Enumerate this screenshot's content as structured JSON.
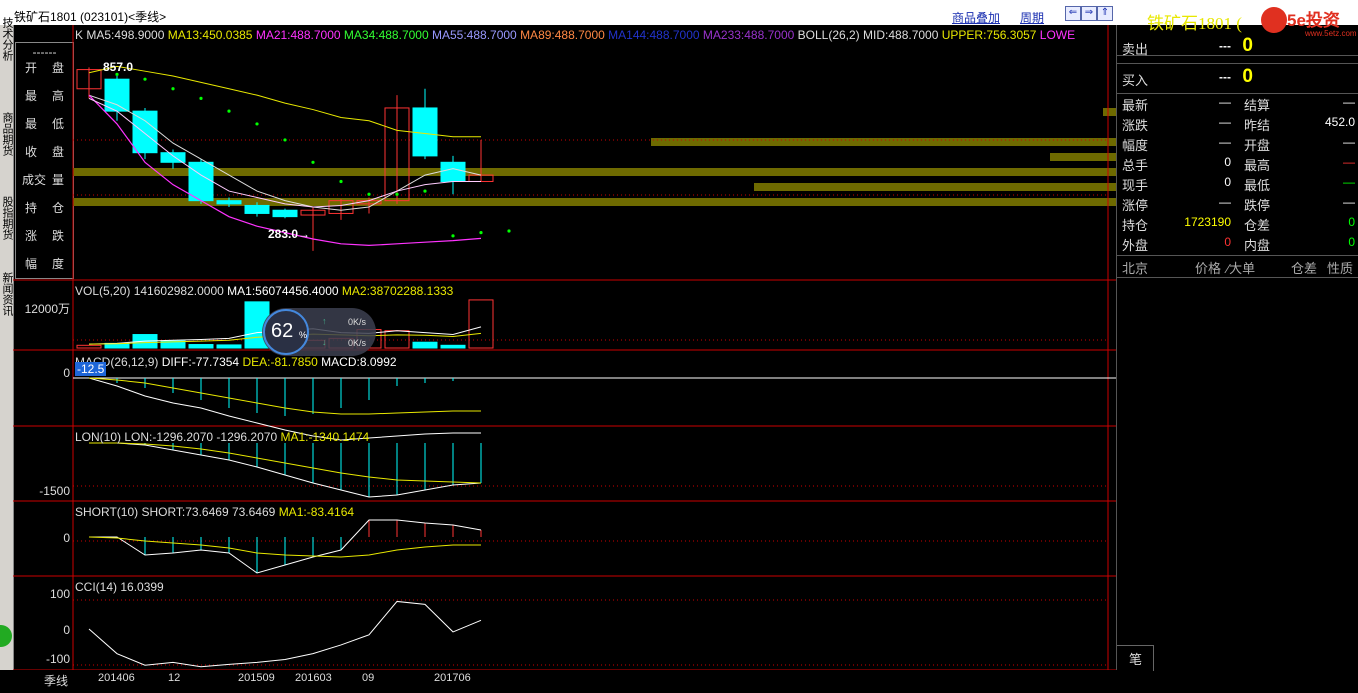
{
  "window": {
    "title": "铁矿石1801 (023101)<季线>",
    "links": {
      "overlay": "商品叠加",
      "period": "周期"
    },
    "nav_buttons": [
      "⇐",
      "⇒",
      "⇑",
      "⇓"
    ]
  },
  "left_tabs": [
    "技术分析",
    "商品期货",
    "股指期货",
    "新闻资讯"
  ],
  "info_box": {
    "dashes": "------",
    "rows": [
      {
        "a": "开",
        "b": "盘"
      },
      {
        "a": "最",
        "b": "高"
      },
      {
        "a": "最",
        "b": "低"
      },
      {
        "a": "收",
        "b": "盘"
      },
      {
        "a": "成交",
        "b": "量"
      },
      {
        "a": "持",
        "b": "仓"
      },
      {
        "a": "涨",
        "b": "跌"
      },
      {
        "a": "幅",
        "b": "度"
      }
    ]
  },
  "kline_header": [
    {
      "text": "K",
      "color": "#dddddd"
    },
    {
      "text": "MA5:498.9000",
      "color": "#dddddd"
    },
    {
      "text": "MA13:450.0385",
      "color": "#e8e800"
    },
    {
      "text": "MA21:488.7000",
      "color": "#ff33ff"
    },
    {
      "text": "MA34:488.7000",
      "color": "#33ff33"
    },
    {
      "text": "MA55:488.7000",
      "color": "#9999ff"
    },
    {
      "text": "MA89:488.7000",
      "color": "#ff8844"
    },
    {
      "text": "MA144:488.7000",
      "color": "#2233cc"
    },
    {
      "text": "MA233:488.7000",
      "color": "#9933cc"
    },
    {
      "text": "BOLL(26,2)",
      "color": "#dddddd"
    },
    {
      "text": "MID:488.7000",
      "color": "#dddddd"
    },
    {
      "text": "UPPER:756.3057",
      "color": "#e8e800"
    },
    {
      "text": "LOWE",
      "color": "#ff33ff"
    }
  ],
  "kline_marks": {
    "high": "857.0",
    "low": "283.0→"
  },
  "candles": [
    {
      "o": 790,
      "c": 850,
      "h": 857,
      "l": 760
    },
    {
      "o": 820,
      "c": 720,
      "h": 830,
      "l": 690
    },
    {
      "o": 720,
      "c": 590,
      "h": 730,
      "l": 570
    },
    {
      "o": 590,
      "c": 560,
      "h": 600,
      "l": 540
    },
    {
      "o": 560,
      "c": 440,
      "h": 570,
      "l": 430
    },
    {
      "o": 440,
      "c": 430,
      "h": 450,
      "l": 420
    },
    {
      "o": 425,
      "c": 400,
      "h": 435,
      "l": 390
    },
    {
      "o": 410,
      "c": 390,
      "h": 415,
      "l": 385
    },
    {
      "o": 395,
      "c": 410,
      "h": 420,
      "l": 283
    },
    {
      "o": 400,
      "c": 440,
      "h": 445,
      "l": 380
    },
    {
      "o": 430,
      "c": 440,
      "h": 450,
      "l": 400
    },
    {
      "o": 440,
      "c": 730,
      "h": 770,
      "l": 430
    },
    {
      "o": 730,
      "c": 580,
      "h": 790,
      "l": 570
    },
    {
      "o": 560,
      "c": 500,
      "h": 580,
      "l": 460
    },
    {
      "o": 500,
      "c": 520,
      "h": 630,
      "l": 500
    }
  ],
  "vol_panel": {
    "label": "VOL(5,20)  141602982.0000",
    "ma1": "MA1:56074456.4000",
    "ma2": "MA2:38702288.1333",
    "axis": "12000万",
    "values": [
      7,
      12,
      35,
      18,
      9,
      8,
      120,
      12,
      20,
      25,
      48,
      45,
      15,
      7,
      125
    ]
  },
  "macd_panel": {
    "label": "MACD(26,12,9)",
    "diff": "DIFF:-77.7354",
    "dea": "DEA:-81.7850",
    "macd": "MACD:8.0992",
    "axis": "0",
    "badge": "-12.5"
  },
  "lon_panel": {
    "label": "LON(10)  LON:-1296.2070  -1296.2070",
    "ma1": "MA1:-1340.1474",
    "axis": "-1500"
  },
  "short_panel": {
    "label": "SHORT(10)  SHORT:73.6469  73.6469",
    "ma1": "MA1:-83.4164",
    "axis": "0"
  },
  "cci_panel": {
    "label": "CCI(14)  16.0399",
    "axis": [
      "100",
      "0",
      "-100"
    ],
    "values": [
      0,
      -85,
      -125,
      -115,
      -130,
      -122,
      -115,
      -105,
      -85,
      -55,
      -20,
      95,
      85,
      -10,
      30
    ]
  },
  "x_axis": {
    "period_label": "季线",
    "ticks": [
      "201406",
      "12",
      "201509",
      "201603",
      "09",
      "201706"
    ]
  },
  "speed_widget": {
    "percent": "62",
    "unit": "%",
    "up": "0K/s",
    "down": "0K/s"
  },
  "quote": {
    "name": "铁矿石1801 (",
    "sell": {
      "label": "卖出",
      "price": "---",
      "vol": "0"
    },
    "buy": {
      "label": "买入",
      "price": "---",
      "vol": "0"
    },
    "rows": [
      {
        "l1": "最新",
        "v1": "—",
        "l2": "结算",
        "v2": "—"
      },
      {
        "l1": "涨跌",
        "v1": "—",
        "l2": "昨结",
        "v2": "452.0"
      },
      {
        "l1": "幅度",
        "v1": "—",
        "l2": "开盘",
        "v2": "—"
      },
      {
        "l1": "总手",
        "v1": "0",
        "l2": "最高",
        "v2": "—"
      },
      {
        "l1": "现手",
        "v1": "0",
        "l2": "最低",
        "v2": "—"
      },
      {
        "l1": "涨停",
        "v1": "—",
        "l2": "跌停",
        "v2": "—"
      },
      {
        "l1": "持仓",
        "v1": "1723190",
        "l2": "仓差",
        "v2": "0"
      },
      {
        "l1": "外盘",
        "v1": "0",
        "l2": "内盘",
        "v2": "0"
      }
    ],
    "table_headers": [
      "北京",
      "价格",
      "⁄大单",
      "仓差",
      "性质"
    ],
    "bottom_tab": "笔"
  },
  "logo": {
    "text": "5e投资",
    "url_text": "www.5etz.com"
  },
  "colors": {
    "up": "#ff3333",
    "down": "#00ffff",
    "axis": "#cc0000",
    "ma5": "#dddddd",
    "ma13": "#e8e800",
    "ma21": "#ff33ff",
    "band": "#6e6a00",
    "yellow": "#ffff00",
    "green": "#00ff00"
  }
}
